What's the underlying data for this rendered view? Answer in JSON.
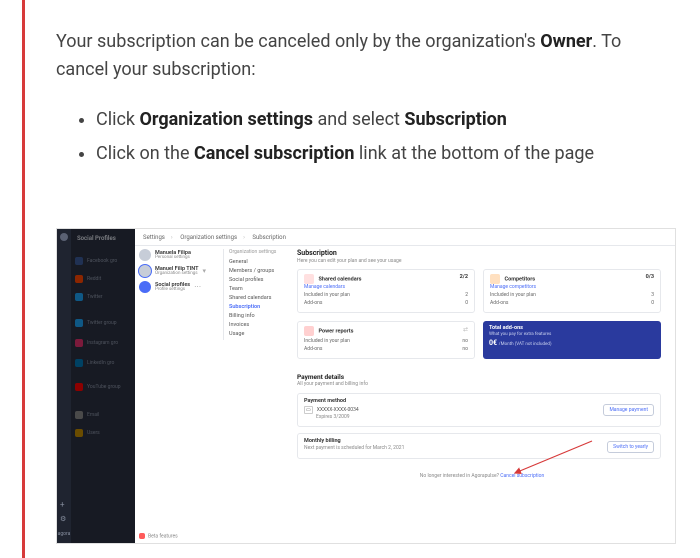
{
  "intro": {
    "part1": "Your subscription can be canceled only by the organization's ",
    "owner": "Owner",
    "part2": ". To cancel your subscription:"
  },
  "steps": [
    {
      "pre": "Click ",
      "b1": "Organization settings",
      "mid": " and select ",
      "b2": "Subscription"
    },
    {
      "pre": "Click on the ",
      "b1": "Cancel subscription",
      "mid": " link at the bottom of the page"
    }
  ],
  "screenshot": {
    "rail": {
      "brand": "agora",
      "plus": "+",
      "gear": "⚙"
    },
    "accounts": {
      "title": "Social Profiles",
      "items": [
        {
          "label": "Facebook gro"
        },
        {
          "label": "Reddit"
        },
        {
          "label": "Twitter"
        },
        {
          "label": "Twitter group"
        },
        {
          "label": "Instagram gro"
        },
        {
          "label": "LinkedIn gro"
        },
        {
          "label": "YouTube group"
        },
        {
          "label": "Email"
        },
        {
          "label": "Users"
        }
      ]
    },
    "crumbs": [
      "Settings",
      "Organization settings",
      "Subscription"
    ],
    "people": [
      {
        "name": "Manuela Filipa",
        "sub": "Personal settings"
      },
      {
        "name": "Manuel Filip TINT",
        "sub": "Organization settings",
        "selected": true
      },
      {
        "name": "Social profiles",
        "sub": "Profile settings"
      }
    ],
    "nav": {
      "header": "Organization settings",
      "items": [
        {
          "label": "General"
        },
        {
          "label": "Members / groups"
        },
        {
          "label": "Social profiles"
        },
        {
          "label": "Team"
        },
        {
          "label": "Shared calendars"
        },
        {
          "label": "Subscription",
          "active": true
        },
        {
          "label": "Billing info"
        },
        {
          "label": "Invoices"
        },
        {
          "label": "Usage"
        }
      ]
    },
    "main": {
      "title": "Subscription",
      "subtitle": "Here you can edit your plan and see your usage",
      "card_calendars": {
        "title": "Shared calendars",
        "link": "Manage calendars",
        "count": "2/2",
        "rows": [
          {
            "k": "Included in your plan",
            "v": "2"
          },
          {
            "k": "Add-ons",
            "v": "0"
          }
        ]
      },
      "card_competitors": {
        "title": "Competitors",
        "link": "Manage competitors",
        "count": "0/3",
        "rows": [
          {
            "k": "Included in your plan",
            "v": "3"
          },
          {
            "k": "Add-ons",
            "v": "0"
          }
        ]
      },
      "card_power": {
        "title": "Power reports",
        "rows": [
          {
            "k": "Included in your plan",
            "v": "no"
          },
          {
            "k": "Add-ons",
            "v": "no"
          }
        ]
      },
      "card_total": {
        "title": "Total add-ons",
        "subtitle": "What you pay for extra features",
        "price": "0€",
        "price_note": "/Month (VAT not included)"
      },
      "payment": {
        "section_title": "Payment details",
        "section_sub": "All your payment and billing info",
        "method_title": "Payment method",
        "method_line1": "XXXXX-XXXX-0034",
        "method_line2": "Expires 3/2009",
        "manage_btn": "Manage payment",
        "billing_title": "Monthly billing",
        "billing_line": "Next payment is scheduled for March 2, 2021",
        "switch_btn": "Switch to yearly"
      },
      "cancel": {
        "text": "No longer interested in Agorapulse? ",
        "link": "Cancel subscription"
      }
    },
    "beta": "Beta features"
  }
}
